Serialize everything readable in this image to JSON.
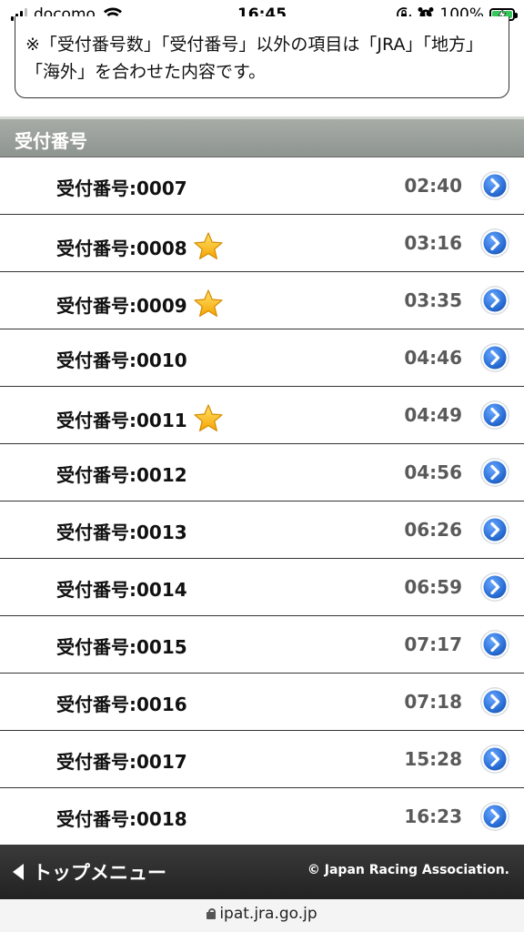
{
  "status_bar": {
    "carrier": "docomo",
    "time": "16:45",
    "battery_percent": "100%",
    "battery_level": 1.0,
    "icons": [
      "signal-icon",
      "wifi-icon",
      "rotation-lock-icon",
      "alarm-icon",
      "battery-charging-icon"
    ]
  },
  "note": {
    "text": "※「受付番号数」「受付番号」以外の項目は「JRA」「地方」「海外」を合わせた内容です。"
  },
  "section": {
    "title": "受付番号"
  },
  "receipts": [
    {
      "label": "受付番号:0007",
      "time": "02:40",
      "starred": false
    },
    {
      "label": "受付番号:0008",
      "time": "03:16",
      "starred": true
    },
    {
      "label": "受付番号:0009",
      "time": "03:35",
      "starred": true
    },
    {
      "label": "受付番号:0010",
      "time": "04:46",
      "starred": false
    },
    {
      "label": "受付番号:0011",
      "time": "04:49",
      "starred": true
    },
    {
      "label": "受付番号:0012",
      "time": "04:56",
      "starred": false
    },
    {
      "label": "受付番号:0013",
      "time": "06:26",
      "starred": false
    },
    {
      "label": "受付番号:0014",
      "time": "06:59",
      "starred": false
    },
    {
      "label": "受付番号:0015",
      "time": "07:17",
      "starred": false
    },
    {
      "label": "受付番号:0016",
      "time": "07:18",
      "starred": false
    },
    {
      "label": "受付番号:0017",
      "time": "15:28",
      "starred": false
    },
    {
      "label": "受付番号:0018",
      "time": "16:23",
      "starred": false
    }
  ],
  "footer": {
    "top_menu_label": "トップメニュー",
    "copyright": "© Japan Racing Association."
  },
  "browser": {
    "url": "ipat.jra.go.jp"
  },
  "colors": {
    "section_header": "#9a9f9a",
    "chevron_blue": "#2f6fd0",
    "star_gold": "#f5b400",
    "footer_bg": "#2c2c2c",
    "battery_green": "#34c759"
  }
}
